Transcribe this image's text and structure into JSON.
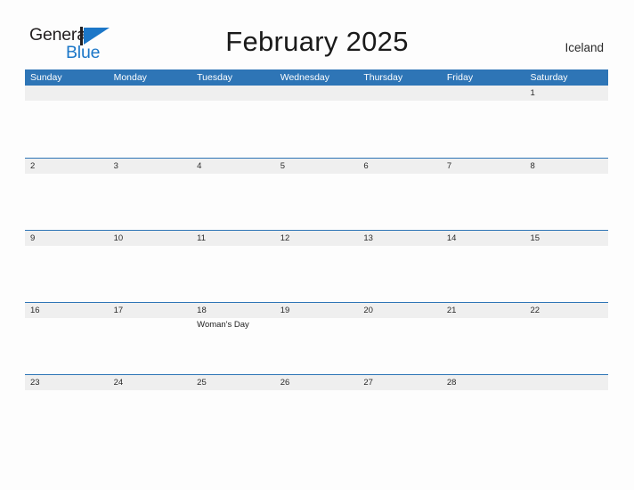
{
  "brand": {
    "name_part1": "General",
    "name_part2": "Blue",
    "flag_icon": "blue-flag-icon",
    "accent_color": "#1c77c8"
  },
  "header": {
    "title": "February 2025",
    "locale": "Iceland"
  },
  "calendar": {
    "header_color": "#2e75b6",
    "date_band_color": "#efefef",
    "weekday_labels": [
      "Sunday",
      "Monday",
      "Tuesday",
      "Wednesday",
      "Thursday",
      "Friday",
      "Saturday"
    ],
    "weeks": [
      {
        "days": [
          {
            "date": "",
            "events": []
          },
          {
            "date": "",
            "events": []
          },
          {
            "date": "",
            "events": []
          },
          {
            "date": "",
            "events": []
          },
          {
            "date": "",
            "events": []
          },
          {
            "date": "",
            "events": []
          },
          {
            "date": "1",
            "events": []
          }
        ]
      },
      {
        "days": [
          {
            "date": "2",
            "events": []
          },
          {
            "date": "3",
            "events": []
          },
          {
            "date": "4",
            "events": []
          },
          {
            "date": "5",
            "events": []
          },
          {
            "date": "6",
            "events": []
          },
          {
            "date": "7",
            "events": []
          },
          {
            "date": "8",
            "events": []
          }
        ]
      },
      {
        "days": [
          {
            "date": "9",
            "events": []
          },
          {
            "date": "10",
            "events": []
          },
          {
            "date": "11",
            "events": []
          },
          {
            "date": "12",
            "events": []
          },
          {
            "date": "13",
            "events": []
          },
          {
            "date": "14",
            "events": []
          },
          {
            "date": "15",
            "events": []
          }
        ]
      },
      {
        "days": [
          {
            "date": "16",
            "events": []
          },
          {
            "date": "17",
            "events": []
          },
          {
            "date": "18",
            "events": [
              "Woman's Day"
            ]
          },
          {
            "date": "19",
            "events": []
          },
          {
            "date": "20",
            "events": []
          },
          {
            "date": "21",
            "events": []
          },
          {
            "date": "22",
            "events": []
          }
        ]
      },
      {
        "days": [
          {
            "date": "23",
            "events": []
          },
          {
            "date": "24",
            "events": []
          },
          {
            "date": "25",
            "events": []
          },
          {
            "date": "26",
            "events": []
          },
          {
            "date": "27",
            "events": []
          },
          {
            "date": "28",
            "events": []
          },
          {
            "date": "",
            "events": []
          }
        ]
      }
    ]
  }
}
